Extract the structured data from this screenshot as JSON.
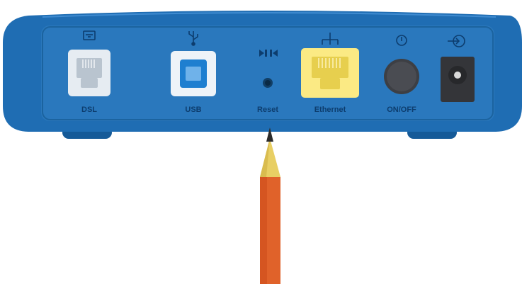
{
  "colors": {
    "body_blue": "#1f6db3",
    "body_dark": "#155a98",
    "panel_blue": "#2a78bd",
    "label_dark": "#0d3d6e",
    "ethernet_yellow": "#fbea84",
    "usb_blue": "#1f7fd0",
    "pencil_orange": "#e0622a",
    "pencil_tip": "#e8cf64",
    "lead": "#2b2b2b"
  },
  "ports": [
    {
      "id": "dsl",
      "label": "DSL",
      "icon": "phone-icon"
    },
    {
      "id": "usb",
      "label": "USB",
      "icon": "usb-icon"
    },
    {
      "id": "reset",
      "label": "Reset",
      "icon": "reset-icon"
    },
    {
      "id": "ethernet",
      "label": "Ethernet",
      "icon": "network-icon"
    },
    {
      "id": "power",
      "label": "ON/OFF",
      "icon": "power-icon"
    },
    {
      "id": "dc",
      "label": "",
      "icon": "dc-input-icon"
    }
  ]
}
